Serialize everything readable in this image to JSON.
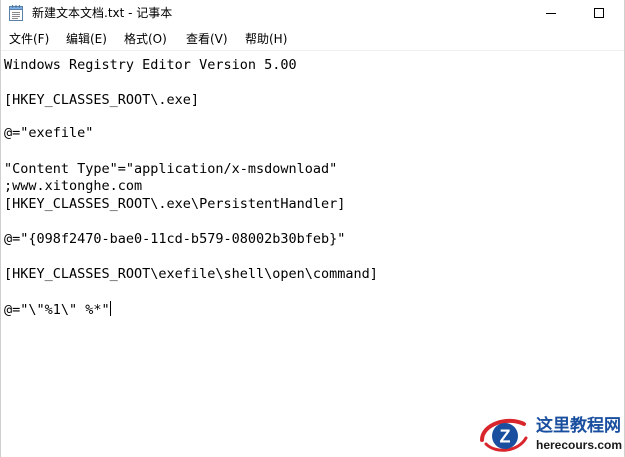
{
  "window": {
    "title": "新建文本文档.txt - 记事本"
  },
  "menu": {
    "items": [
      {
        "label": "文件(F)"
      },
      {
        "label": "编辑(E)"
      },
      {
        "label": "格式(O)"
      },
      {
        "label": "查看(V)"
      },
      {
        "label": "帮助(H)"
      }
    ]
  },
  "editor": {
    "lines": [
      "Windows Registry Editor Version 5.00",
      "[HKEY_CLASSES_ROOT\\.exe]",
      "@=\"exefile\"",
      "\"Content Type\"=\"application/x-msdownload\"",
      ";www.xitonghe.com",
      "[HKEY_CLASSES_ROOT\\.exe\\PersistentHandler]",
      "@=\"{098f2470-bae0-11cd-b579-08002b30bfeb}\"",
      "[HKEY_CLASSES_ROOT\\exefile\\shell\\open\\command]",
      "@=\"\\\"%1\\\" %*\""
    ]
  },
  "watermark": {
    "title": "这里教程网",
    "url": "herecours.com"
  },
  "icons": {
    "app": "notepad-icon",
    "minimize": "minimize-icon",
    "maximize": "maximize-icon"
  },
  "colors": {
    "text": "#000000",
    "background": "#ffffff",
    "watermark_blue": "#1a4fa0",
    "watermark_red": "#d9262c"
  }
}
